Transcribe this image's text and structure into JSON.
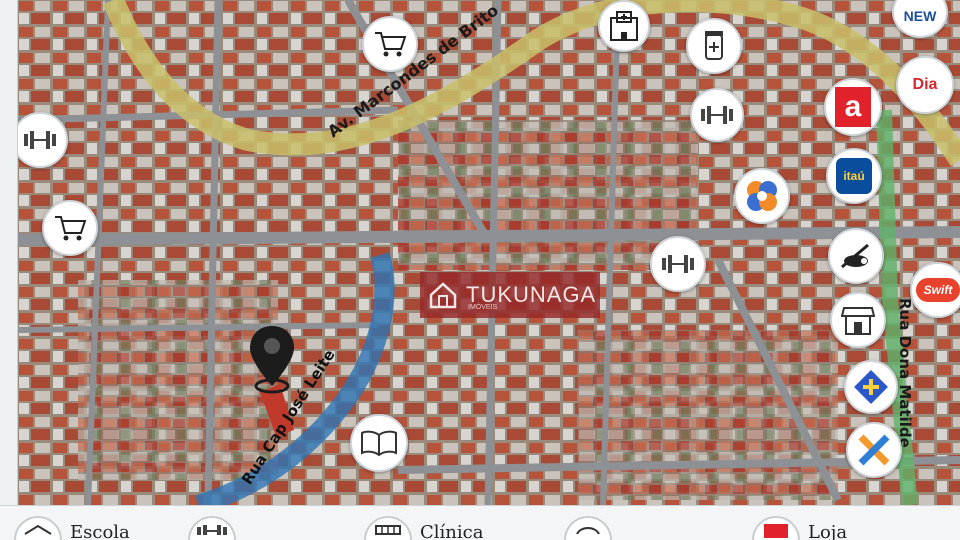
{
  "map": {
    "streets": {
      "avenue": "Av. Marcondes de Brito",
      "rua_cap": "Rua Cap José Leite",
      "rua_dona": "Rua Dona Matilde"
    },
    "watermark": {
      "brand": "TUKUNAGA",
      "sub": "IMÓVEIS"
    },
    "pois": [
      {
        "id": "hospital",
        "icon": "hospital-icon"
      },
      {
        "id": "market-top",
        "icon": "shopping-cart-icon"
      },
      {
        "id": "pharmacy",
        "icon": "pharmacy-icon"
      },
      {
        "id": "gym-top",
        "icon": "gym-icon"
      },
      {
        "id": "gym-left",
        "icon": "gym-icon"
      },
      {
        "id": "market-left",
        "icon": "shopping-cart-icon"
      },
      {
        "id": "gym-center",
        "icon": "gym-icon"
      },
      {
        "id": "bakery",
        "icon": "bakery-icon"
      },
      {
        "id": "store",
        "icon": "store-icon"
      },
      {
        "id": "school",
        "icon": "book-icon"
      },
      {
        "id": "new",
        "icon": "new-store-logo",
        "text": "NEW"
      },
      {
        "id": "dia",
        "icon": "dia-logo",
        "text": "Dia"
      },
      {
        "id": "americanas",
        "icon": "americanas-logo",
        "text": "a"
      },
      {
        "id": "itau",
        "icon": "itau-logo",
        "text": "itaú"
      },
      {
        "id": "clinic-plus",
        "icon": "clinic-plus-icon"
      },
      {
        "id": "swift",
        "icon": "swift-logo",
        "text": "Swift"
      },
      {
        "id": "bb",
        "icon": "banco-do-brasil-logo"
      },
      {
        "id": "santander-x",
        "icon": "bank-x-logo"
      }
    ],
    "pin": {
      "icon": "location-pin-icon"
    }
  },
  "legend": {
    "items": [
      {
        "label": "Escola",
        "icon": "school-icon"
      },
      {
        "label": "",
        "icon": "gym-icon"
      },
      {
        "label": "Clínica",
        "icon": "clinic-icon"
      },
      {
        "label": "",
        "icon": "bank-icon"
      },
      {
        "label": "Loja",
        "icon": "store-logo-icon"
      }
    ]
  },
  "colors": {
    "avenue": "#c9c06a",
    "rua_cap": "#2e74b5",
    "rua_dona": "#5fb36a",
    "watermark": "#962828",
    "pin": "#1c1c1c",
    "lot": "#c0392b"
  }
}
